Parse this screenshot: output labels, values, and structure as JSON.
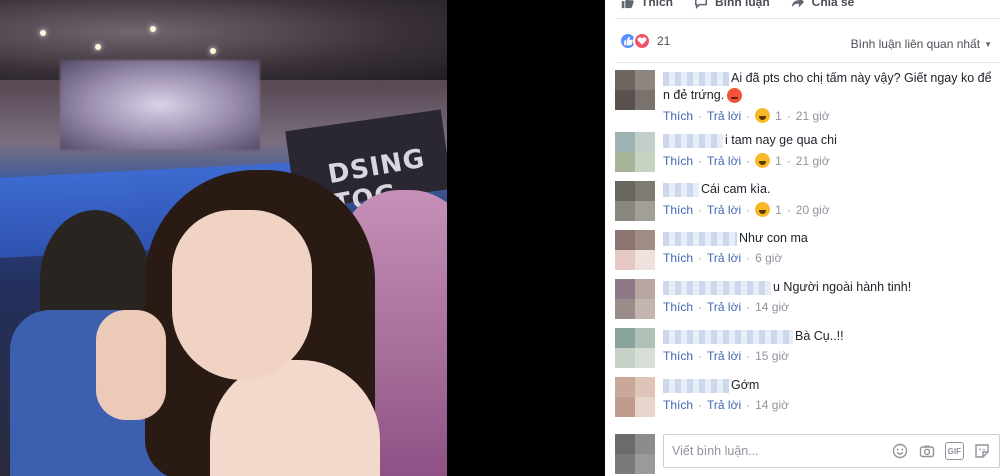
{
  "actions": {
    "like_label": "Thích",
    "comment_label": "Bình luận",
    "share_label": "Chia sẻ"
  },
  "reactions": {
    "count": "21"
  },
  "sort": {
    "label": "Bình luận liên quan nhất"
  },
  "comments": [
    {
      "text": "Ai đã pts cho chị tấm này vậy? Giết ngay ko để n đẻ trứng.",
      "like": "Thích",
      "reply": "Trả lời",
      "reaction_count": "1",
      "time": "21 giờ"
    },
    {
      "text": "i tam nay ge qua chi",
      "like": "Thích",
      "reply": "Trả lời",
      "reaction_count": "1",
      "time": "21 giờ"
    },
    {
      "text": "Cái cam kìa.",
      "like": "Thích",
      "reply": "Trả lời",
      "reaction_count": "1",
      "time": "20 giờ"
    },
    {
      "text": "Như con ma",
      "like": "Thích",
      "reply": "Trả lời",
      "time": "6 giờ"
    },
    {
      "text": "u Người ngoài hành tinh!",
      "like": "Thích",
      "reply": "Trả lời",
      "time": "14 giờ"
    },
    {
      "text": "Bà Cụ..!!",
      "like": "Thích",
      "reply": "Trả lời",
      "time": "15 giờ"
    },
    {
      "text": "Gớm",
      "like": "Thích",
      "reply": "Trả lời",
      "time": "14 giờ"
    }
  ],
  "reply_box": {
    "placeholder": "Viết bình luận..."
  },
  "photo": {
    "banner_text": "DSING TOG"
  },
  "colors": {
    "link": "#4267b2",
    "meta": "#90949c",
    "like_reaction": "#5890ff",
    "love_reaction": "#f25268",
    "haha_reaction": "#f7b928"
  }
}
